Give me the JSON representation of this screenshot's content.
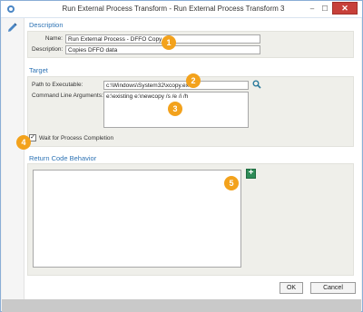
{
  "window": {
    "title": "Run External Process Transform - Run External Process Transform 3",
    "minimize_glyph": "–",
    "maximize_glyph": "☐",
    "close_glyph": "✕"
  },
  "description": {
    "header": "Description",
    "name_label": "Name:",
    "name_value": "Run External Process - DFFO Copy",
    "desc_label": "Description:",
    "desc_value": "Copies DFFO data"
  },
  "target": {
    "header": "Target",
    "path_label": "Path to Executable:",
    "path_value": "c:\\Windows\\System32\\xcopy.exe",
    "args_label": "Command Line Arguments:",
    "args_value": "e:\\existing e:\\newcopy /s /e /i /h"
  },
  "wait": {
    "label": "Wait for Process Completion",
    "checked": true,
    "check_glyph": "✓"
  },
  "return_code": {
    "header": "Return Code Behavior",
    "add_glyph": "+"
  },
  "badges": [
    "1",
    "2",
    "3",
    "4",
    "5"
  ],
  "buttons": {
    "ok": "OK",
    "cancel": "Cancel"
  },
  "colors": {
    "accent": "#2f74b5",
    "badge": "#f3a21c",
    "close": "#c7403a",
    "add_button": "#2e8b57"
  }
}
